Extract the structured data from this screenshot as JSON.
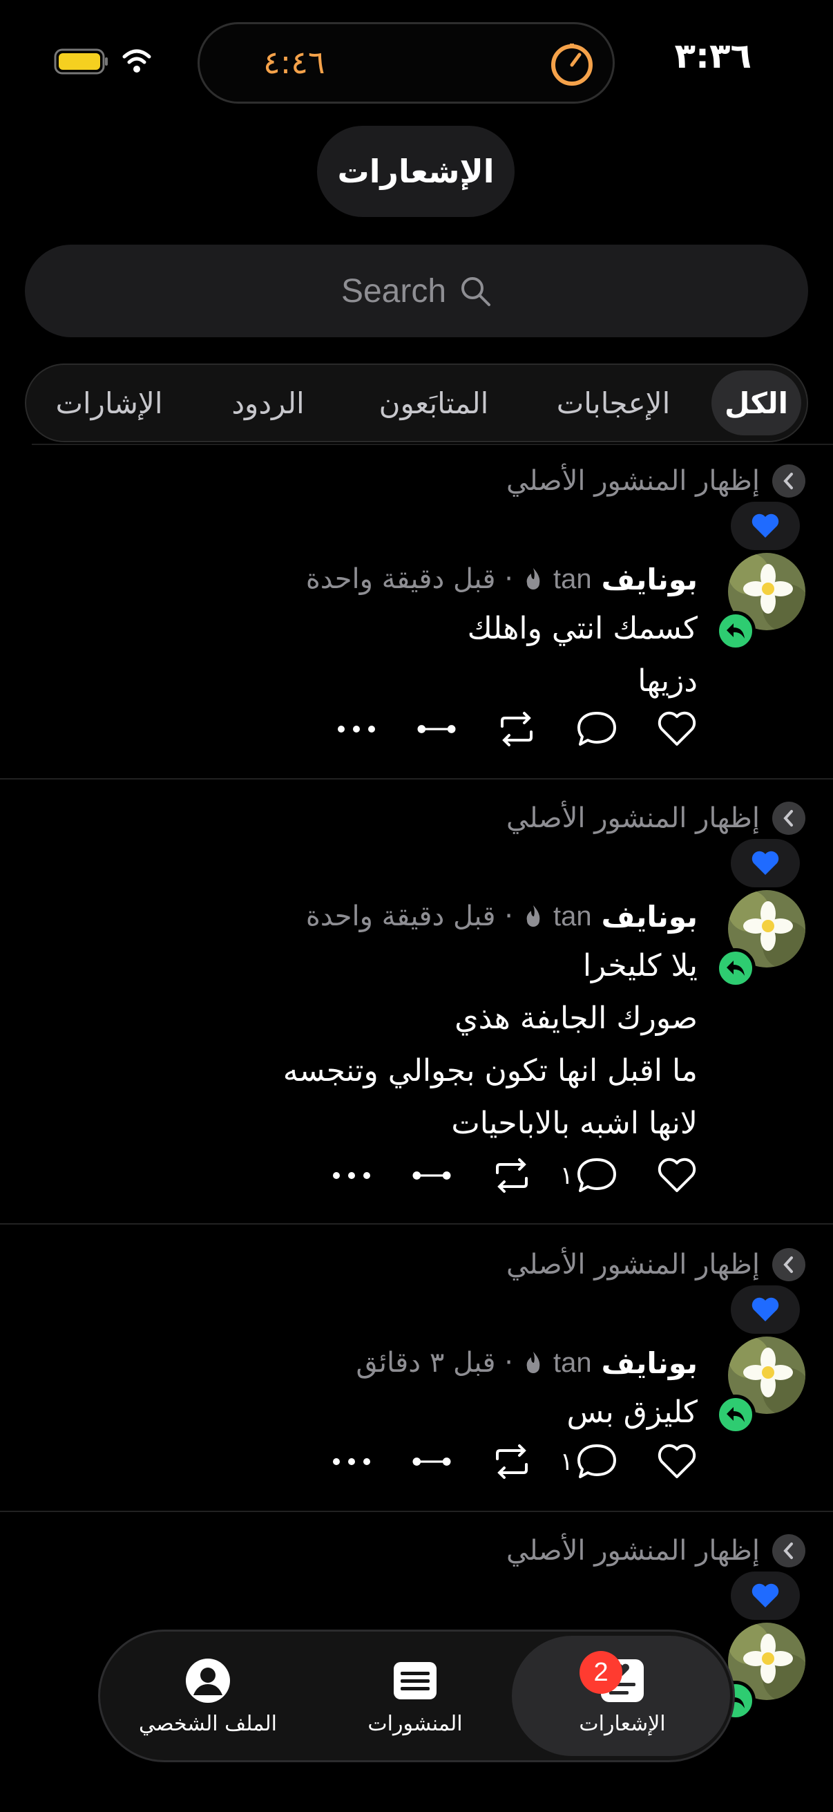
{
  "status_bar": {
    "time": "٣:٣٦",
    "island_timer": "٤:٤٦"
  },
  "page_title": "الإشعارات",
  "search": {
    "placeholder": "Search"
  },
  "tabs": [
    {
      "label": "الكل",
      "active": true
    },
    {
      "label": "الإعجابات",
      "active": false
    },
    {
      "label": "المتابَعون",
      "active": false
    },
    {
      "label": "الردود",
      "active": false
    },
    {
      "label": "الإشارات",
      "active": false
    }
  ],
  "notifications": [
    {
      "show_original": "إظهار المنشور الأصلي",
      "username": "بونايف",
      "handle": "tan",
      "time": "· قبل دقيقة واحدة",
      "lines": [
        "كسمك انتي واهلك",
        "دزيها"
      ],
      "reply_count": ""
    },
    {
      "show_original": "إظهار المنشور الأصلي",
      "username": "بونايف",
      "handle": "tan",
      "time": "· قبل دقيقة واحدة",
      "lines": [
        "يلا كليخرا",
        "صورك الجايفة هذي",
        "ما اقبل انها تكون بجوالي وتنجسه",
        "لانها اشبه بالاباحيات"
      ],
      "reply_count": "١"
    },
    {
      "show_original": "إظهار المنشور الأصلي",
      "username": "بونايف",
      "handle": "tan",
      "time": "· قبل ٣ دقائق",
      "lines": [
        "كليزق بس"
      ],
      "reply_count": "١"
    },
    {
      "show_original": "إظهار المنشور الأصلي"
    }
  ],
  "bottom_nav": {
    "items": [
      {
        "label": "الإشعارات",
        "icon": "notifications-icon",
        "active": true,
        "badge": "2"
      },
      {
        "label": "المنشورات",
        "icon": "posts-icon",
        "active": false
      },
      {
        "label": "الملف الشخصي",
        "icon": "profile-icon",
        "active": false
      }
    ]
  },
  "colors": {
    "background": "#000000",
    "accent_green": "#2ecc71",
    "badge_red": "#ff3b30",
    "heart_blue": "#1f6bff",
    "timer_orange": "#f5a24a"
  }
}
